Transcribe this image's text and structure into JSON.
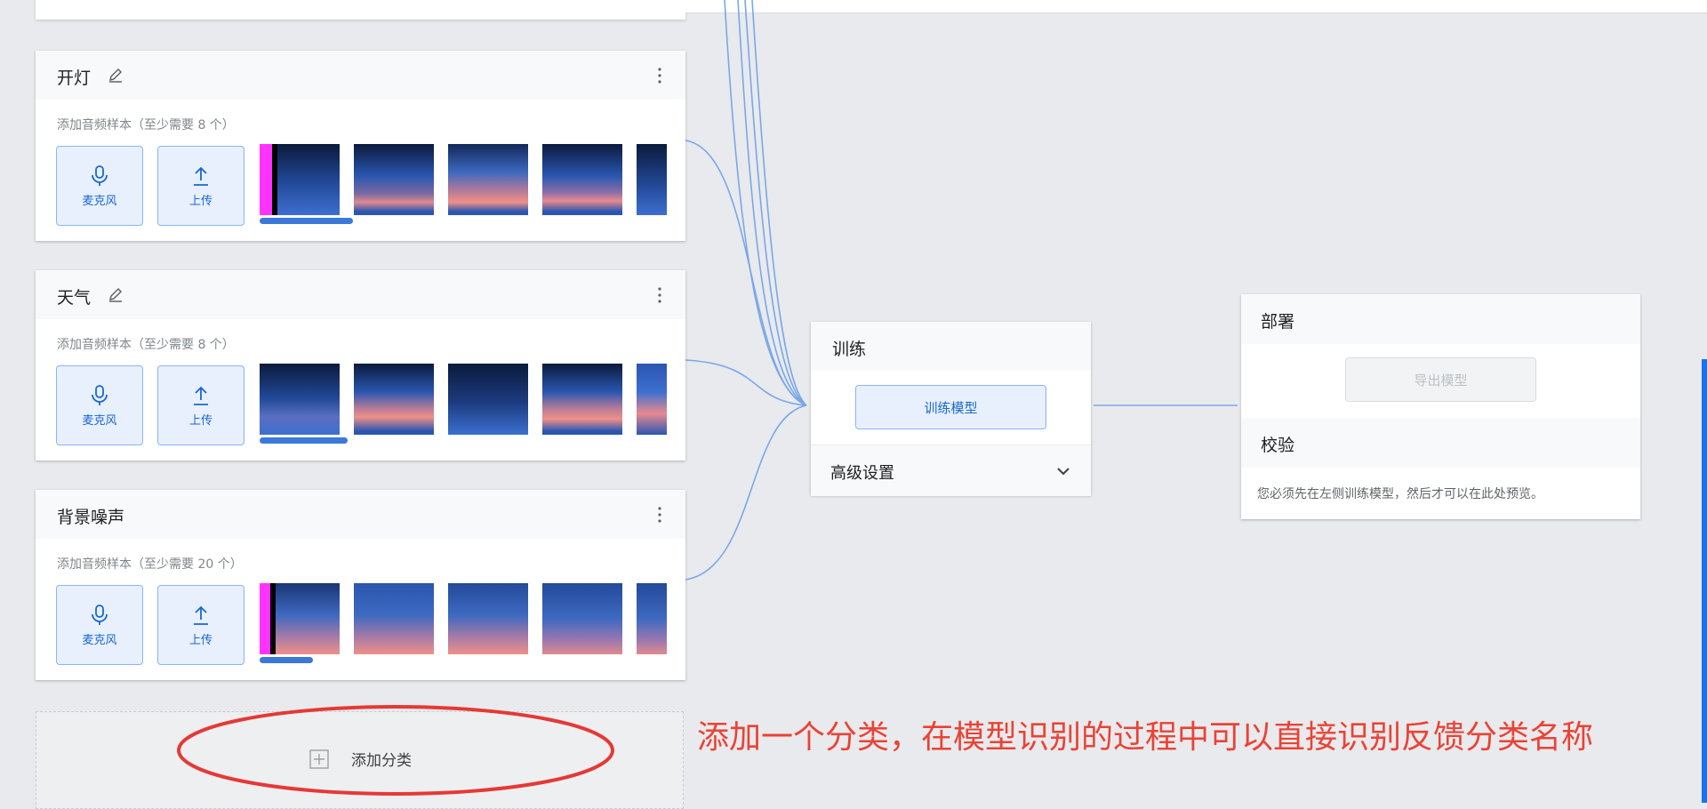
{
  "classes": [
    {
      "name": "开灯",
      "subtitle": "添加音频样本（至少需要 8 个）",
      "mic_label": "麦克风",
      "upload_label": "上传",
      "editable": true
    },
    {
      "name": "天气",
      "subtitle": "添加音频样本（至少需要 8 个）",
      "mic_label": "麦克风",
      "upload_label": "上传",
      "editable": true
    },
    {
      "name": "背景噪声",
      "subtitle": "添加音频样本（至少需要 20 个）",
      "mic_label": "麦克风",
      "upload_label": "上传",
      "editable": false
    }
  ],
  "add_class": {
    "label": "添加分类"
  },
  "training": {
    "title": "训练",
    "button": "训练模型",
    "advanced": "高级设置"
  },
  "deploy": {
    "title": "部署",
    "export_button": "导出模型",
    "verify_title": "校验",
    "verify_note": "您必须先在左侧训练模型，然后才可以在此处预览。"
  },
  "annotation": "添加一个分类，在模型识别的过程中可以直接识别反馈分类名称",
  "colors": {
    "accent": "#1967d2",
    "annotation": "#ea4335",
    "wire": "#7aa7e8",
    "recording_marker": "#ff1fff"
  },
  "icons": [
    "pencil-icon",
    "more-vert-icon",
    "mic-icon",
    "upload-icon",
    "chevron-down-icon",
    "add-box-icon"
  ]
}
